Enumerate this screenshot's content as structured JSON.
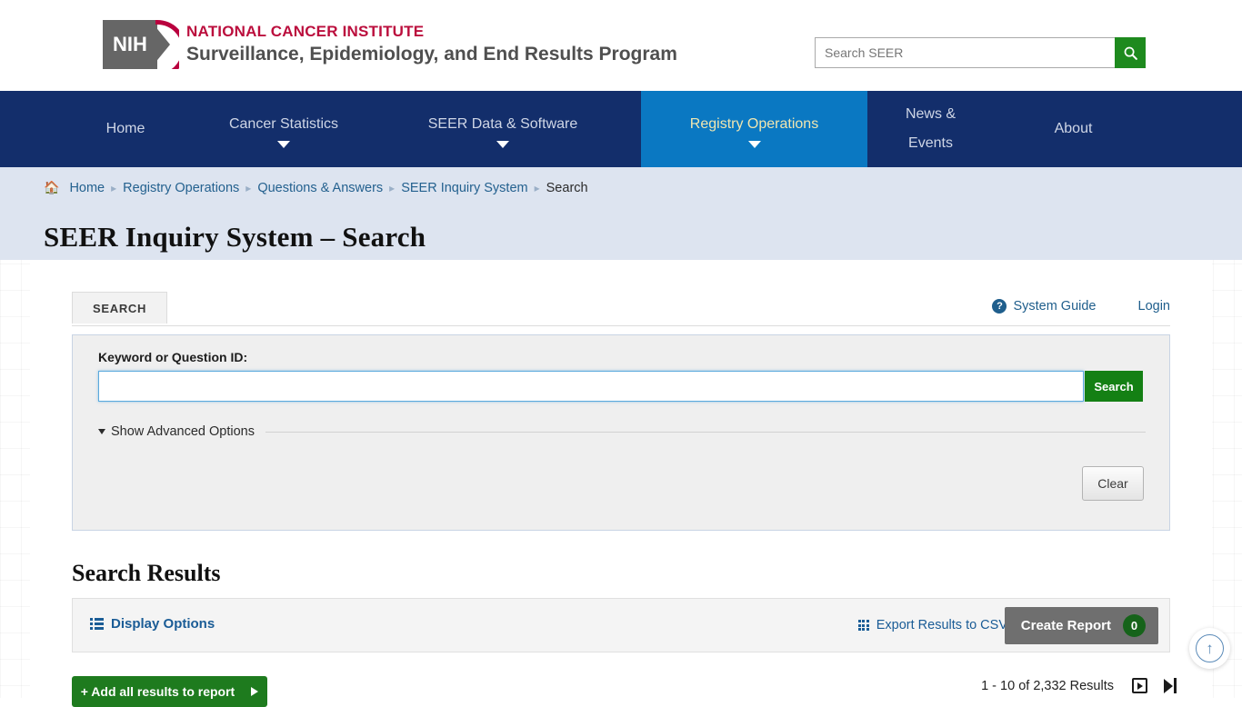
{
  "header": {
    "logo": {
      "mark_text": "NIH",
      "line1": "NATIONAL CANCER INSTITUTE",
      "line2": "Surveillance, Epidemiology, and End Results Program"
    },
    "search": {
      "placeholder": "Search SEER",
      "value": "",
      "button_icon": "search-icon"
    }
  },
  "nav": {
    "items": [
      {
        "label": "Home",
        "label2": "",
        "has_caret": false,
        "active": false
      },
      {
        "label": "Cancer Statistics",
        "label2": "",
        "has_caret": true,
        "active": false
      },
      {
        "label": "SEER Data & Software",
        "label2": "",
        "has_caret": true,
        "active": false
      },
      {
        "label": "Registry Operations",
        "label2": "",
        "has_caret": true,
        "active": true
      },
      {
        "label": "News &",
        "label2": "Events",
        "has_caret": false,
        "active": false
      },
      {
        "label": "About",
        "label2": "",
        "has_caret": false,
        "active": false
      }
    ]
  },
  "breadcrumb": {
    "home_icon": "home-icon",
    "items": [
      {
        "label": "Home",
        "current": false
      },
      {
        "label": "Registry Operations",
        "current": false
      },
      {
        "label": "Questions & Answers",
        "current": false
      },
      {
        "label": "SEER Inquiry System",
        "current": false
      },
      {
        "label": "Search",
        "current": true
      }
    ],
    "separator": "▸"
  },
  "page": {
    "title": "SEER Inquiry System – Search"
  },
  "tabs": {
    "search_tab": "SEARCH",
    "system_guide": "System Guide",
    "system_guide_icon": "question-circle-icon",
    "login": "Login"
  },
  "search_panel": {
    "field_label": "Keyword or Question ID:",
    "input_value": "",
    "input_placeholder": "",
    "search_button": "Search",
    "advanced_toggle": "Show Advanced Options",
    "clear_button": "Clear"
  },
  "results": {
    "heading": "Search Results",
    "display_options": "Display Options",
    "display_options_icon": "list-icon",
    "export_csv": "Export Results to CSV",
    "export_csv_icon": "grid-icon",
    "create_report": "Create Report",
    "create_report_count": "0",
    "add_all": "+ Add all results to report",
    "count_text": "1 - 10 of 2,332 Results",
    "pager_next_icon": "next-page-icon",
    "pager_last_icon": "last-page-icon"
  },
  "back_to_top": {
    "icon": "arrow-up-icon",
    "glyph": "↑"
  },
  "colors": {
    "nav_blue": "#132e6b",
    "nav_active_blue": "#0a78c2",
    "brand_red": "#bb0e3d",
    "link_blue": "#1f5e8c",
    "green": "#148014",
    "breadcrumb_band": "#dde4f0"
  }
}
